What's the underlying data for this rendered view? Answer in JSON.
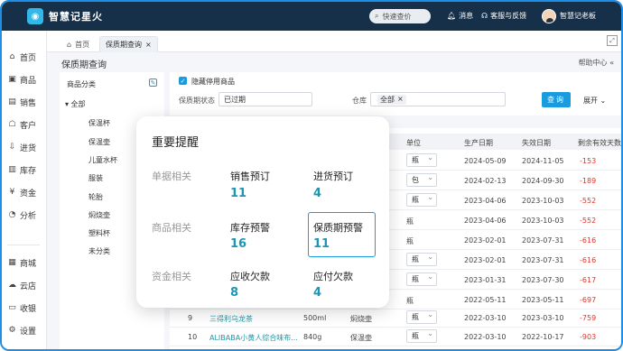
{
  "app": {
    "title": "智慧记星火",
    "logo_glyph": "◉"
  },
  "topbar": {
    "search_label": "快速查价",
    "messages_label": "消息",
    "service_label": "客服与反馈",
    "user_label": "智慧记老板"
  },
  "sidebar": {
    "items": [
      {
        "label": "首页",
        "icon": "home-icon",
        "glyph": "⌂"
      },
      {
        "label": "商品",
        "icon": "box-icon",
        "glyph": "▣"
      },
      {
        "label": "销售",
        "icon": "sales-icon",
        "glyph": "▤"
      },
      {
        "label": "客户",
        "icon": "customer-icon",
        "glyph": "☖"
      },
      {
        "label": "进货",
        "icon": "purchase-icon",
        "glyph": "⇩"
      },
      {
        "label": "库存",
        "icon": "stock-icon",
        "glyph": "▥"
      },
      {
        "label": "资金",
        "icon": "money-icon",
        "glyph": "¥"
      },
      {
        "label": "分析",
        "icon": "chart-icon",
        "glyph": "◔"
      },
      {
        "label": "商城",
        "icon": "mall-icon",
        "glyph": "▦"
      },
      {
        "label": "云店",
        "icon": "cloud-store-icon",
        "glyph": "☁"
      },
      {
        "label": "收银",
        "icon": "cashier-icon",
        "glyph": "▭"
      },
      {
        "label": "设置",
        "icon": "settings-icon",
        "glyph": "⚙"
      }
    ]
  },
  "tabs": {
    "home_label": "首页",
    "active_label": "保质期查询",
    "close_glyph": "×"
  },
  "page": {
    "title": "保质期查询",
    "help_label": "帮助中心 «"
  },
  "category": {
    "title": "商品分类",
    "root": "▾ 全部",
    "items": [
      "保温杯",
      "保温壶",
      "儿童水杯",
      "服装",
      "轮胎",
      "焖烧壶",
      "塑料杯",
      "未分类"
    ]
  },
  "filter": {
    "hide_disabled_label": "隐藏停用商品",
    "status_label": "保质期状态",
    "status_value": "已过期",
    "warehouse_label": "仓库",
    "warehouse_tag": "全部",
    "query_button": "查询",
    "collapse_label": "展开 ⌄"
  },
  "table": {
    "headers": {
      "unit": "单位",
      "production_date": "生产日期",
      "expiry_date": "失效日期",
      "remaining_days": "剩余有效天数"
    },
    "rows": [
      {
        "no": "",
        "name": "",
        "spec": "",
        "category": "",
        "unit": "瓶",
        "unit_select": true,
        "prod": "2024-05-09",
        "exp": "2024-11-05",
        "days": "-153"
      },
      {
        "no": "",
        "name": "",
        "spec": "",
        "category": "",
        "unit": "包",
        "unit_select": true,
        "prod": "2024-02-13",
        "exp": "2024-09-30",
        "days": "-189"
      },
      {
        "no": "",
        "name": "",
        "spec": "",
        "category": "",
        "unit": "瓶",
        "unit_select": true,
        "prod": "2023-04-06",
        "exp": "2023-10-03",
        "days": "-552"
      },
      {
        "no": "",
        "name": "",
        "spec": "",
        "category": "",
        "unit": "瓶",
        "unit_select": false,
        "prod": "2023-04-06",
        "exp": "2023-10-03",
        "days": "-552"
      },
      {
        "no": "",
        "name": "",
        "spec": "",
        "category": "",
        "unit": "瓶",
        "unit_select": false,
        "prod": "2023-02-01",
        "exp": "2023-07-31",
        "days": "-616"
      },
      {
        "no": "",
        "name": "",
        "spec": "",
        "category": "",
        "unit": "瓶",
        "unit_select": true,
        "prod": "2023-02-01",
        "exp": "2023-07-31",
        "days": "-616"
      },
      {
        "no": "",
        "name": "",
        "spec": "",
        "category": "",
        "unit": "瓶",
        "unit_select": true,
        "prod": "2023-01-31",
        "exp": "2023-07-30",
        "days": "-617"
      },
      {
        "no": "",
        "name": "",
        "spec": "",
        "category": "",
        "unit": "瓶",
        "unit_select": false,
        "prod": "2022-05-11",
        "exp": "2023-05-11",
        "days": "-697"
      },
      {
        "no": "9",
        "name": "三得利乌龙茶",
        "spec": "500ml",
        "category": "焖烧壶",
        "unit": "瓶",
        "unit_select": true,
        "prod": "2022-03-10",
        "exp": "2023-03-10",
        "days": "-759"
      },
      {
        "no": "10",
        "name": "ALIBABA小黄人综合味布...",
        "spec": "840g",
        "category": "保温壶",
        "unit": "瓶",
        "unit_select": true,
        "prod": "2022-03-10",
        "exp": "2022-10-17",
        "days": "-903"
      }
    ]
  },
  "modal": {
    "title": "重要提醒",
    "groups": [
      {
        "label": "单据相关",
        "items": [
          {
            "name": "销售预订",
            "value": "11"
          },
          {
            "name": "进货预订",
            "value": "4"
          }
        ]
      },
      {
        "label": "商品相关",
        "items": [
          {
            "name": "库存预警",
            "value": "16"
          },
          {
            "name": "保质期预警",
            "value": "11"
          }
        ]
      },
      {
        "label": "资金相关",
        "items": [
          {
            "name": "应收欠款",
            "value": "8"
          },
          {
            "name": "应付欠款",
            "value": "4"
          }
        ]
      }
    ]
  },
  "colors": {
    "accent": "#1a9be0",
    "topbar": "#16304a",
    "value_teal": "#1d95b5",
    "negative": "#e0342a"
  }
}
